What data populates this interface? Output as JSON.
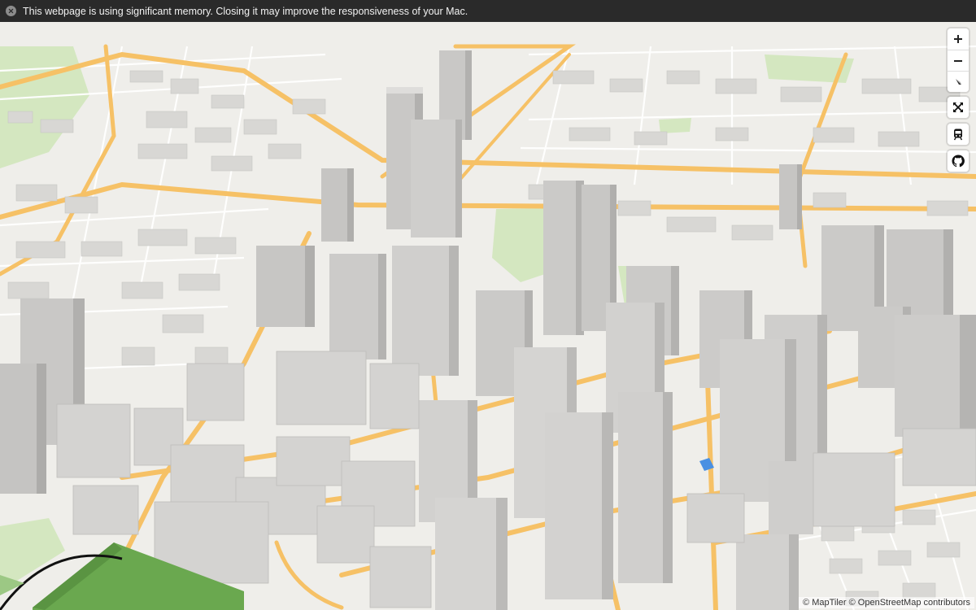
{
  "banner": {
    "message": "This webpage is using significant memory. Closing it may improve the responsiveness of your Mac."
  },
  "map": {
    "attribution": "© MapTiler © OpenStreetMap contributors",
    "colors": {
      "background": "#efeeea",
      "road_major": "#f6c166",
      "road_minor": "#ffffff",
      "park": "#d3e6bf",
      "building_top": "#dcdbd9",
      "building_side": "#bdbcba",
      "green_block": "#6aa84f",
      "water": "#4a90e2"
    }
  },
  "controls": {
    "zoom_in": "+",
    "zoom_out": "−",
    "compass": "compass-icon",
    "fullscreen": "fullscreen-icon",
    "transit": "train-icon",
    "github": "github-icon"
  }
}
